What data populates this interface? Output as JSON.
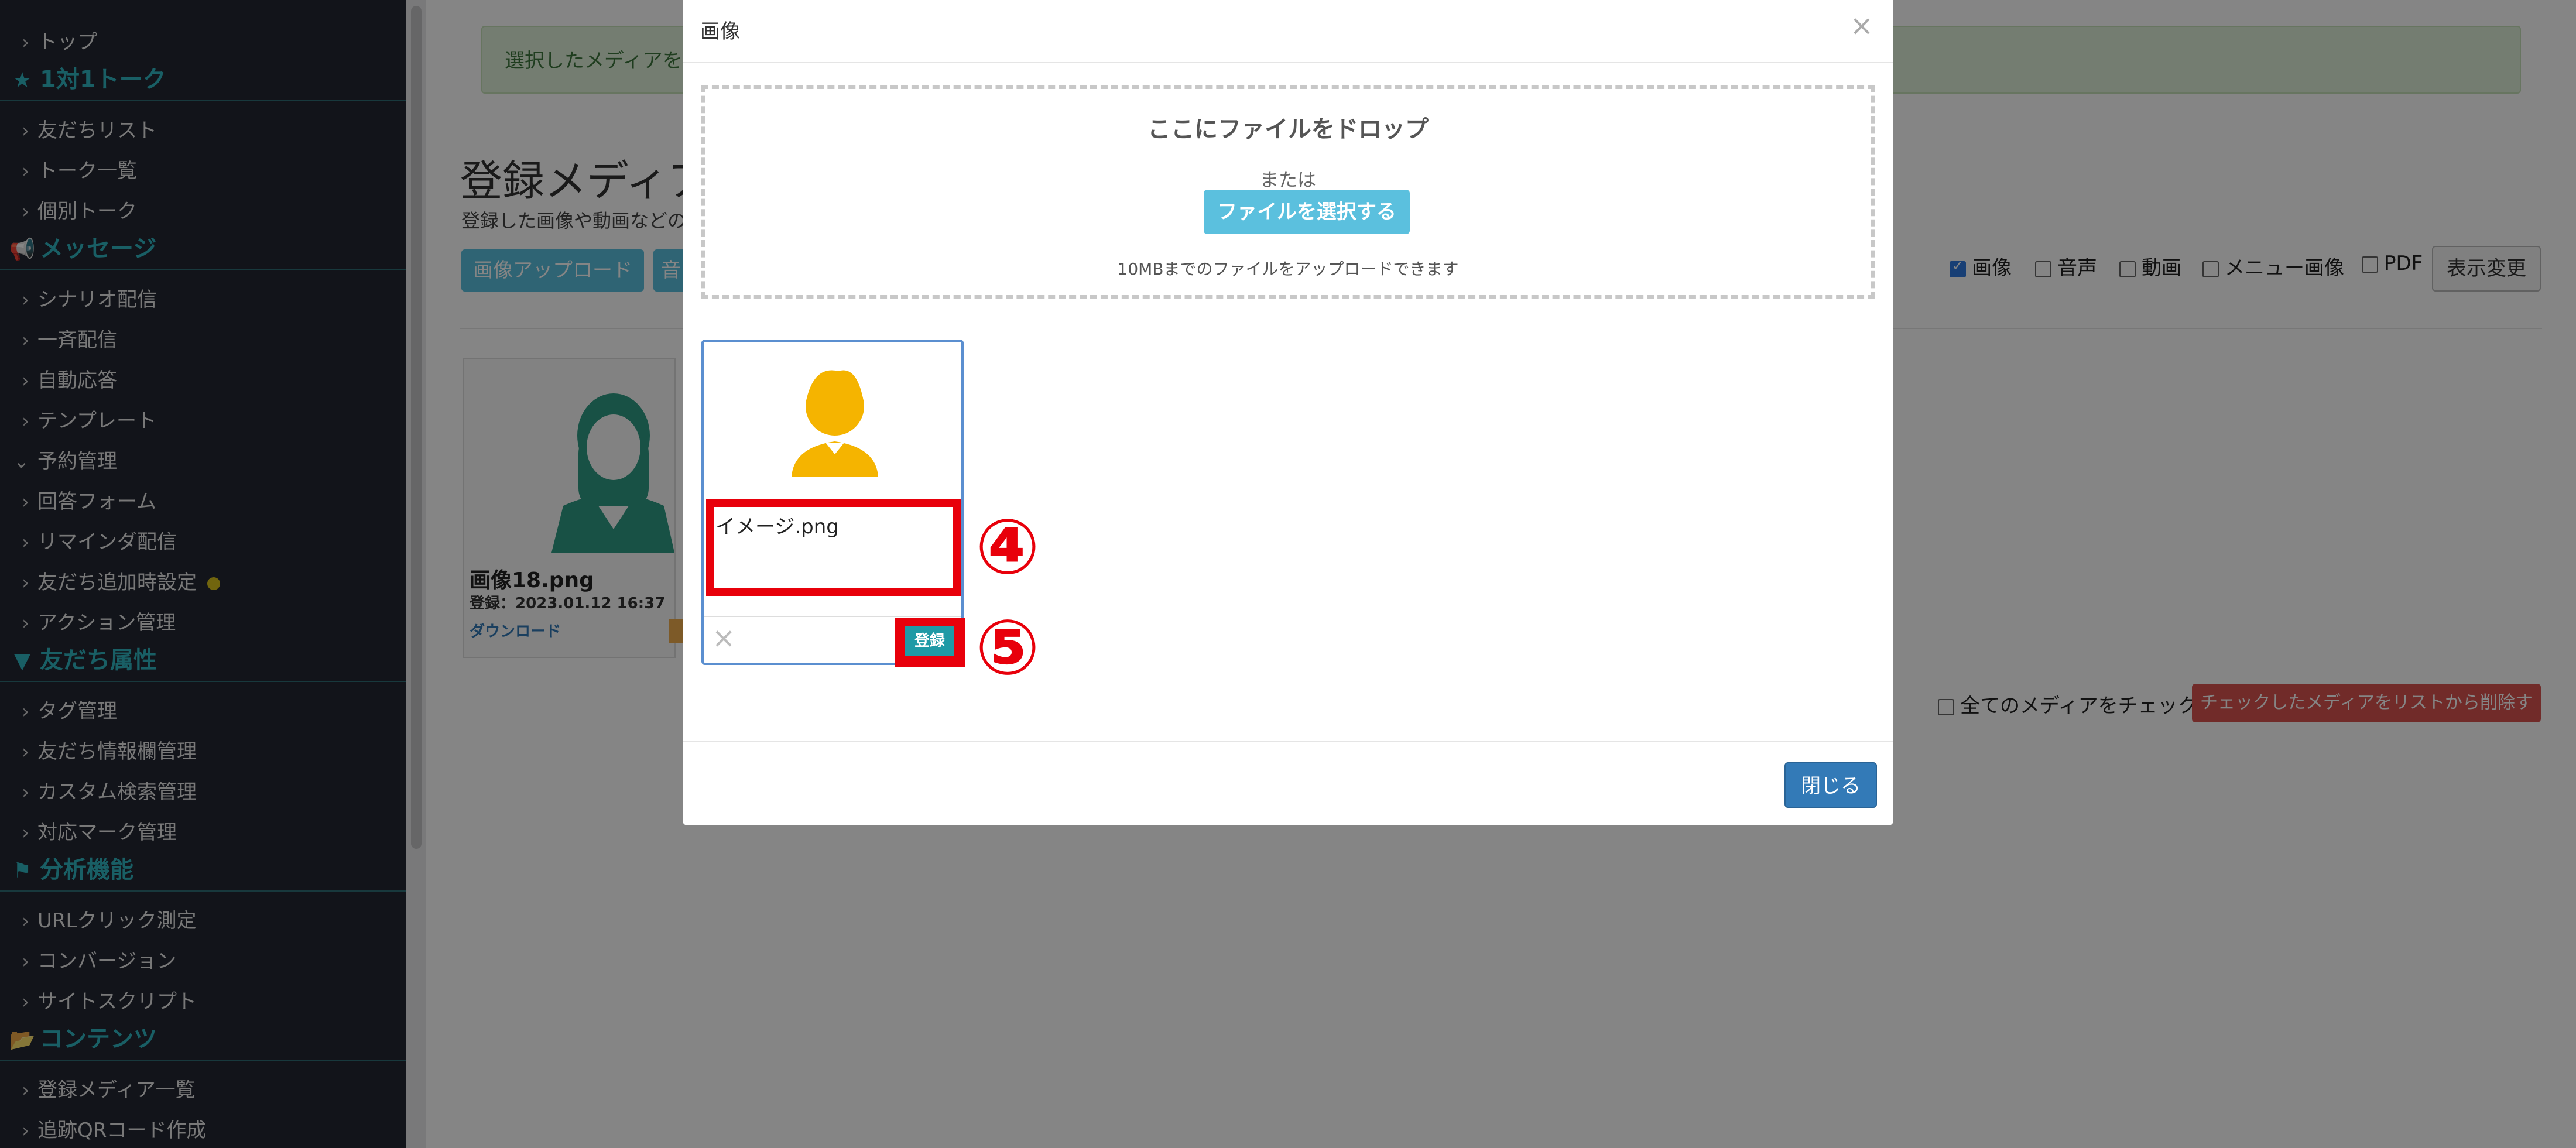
{
  "sidebar": {
    "items": [
      {
        "type": "item",
        "label": "トップ"
      },
      {
        "type": "head",
        "icon": "★",
        "label": "1対1トーク"
      },
      {
        "type": "item",
        "label": "友だちリスト"
      },
      {
        "type": "item",
        "label": "トーク一覧"
      },
      {
        "type": "item",
        "label": "個別トーク"
      },
      {
        "type": "head",
        "icon": "📢",
        "label": "メッセージ"
      },
      {
        "type": "item",
        "label": "シナリオ配信"
      },
      {
        "type": "item",
        "label": "一斉配信"
      },
      {
        "type": "item",
        "label": "自動応答"
      },
      {
        "type": "item",
        "label": "テンプレート"
      },
      {
        "type": "item",
        "label": "予約管理",
        "open": true
      },
      {
        "type": "item",
        "label": "回答フォーム"
      },
      {
        "type": "item",
        "label": "リマインダ配信"
      },
      {
        "type": "item",
        "label": "友だち追加時設定",
        "dot": true
      },
      {
        "type": "item",
        "label": "アクション管理"
      },
      {
        "type": "head",
        "icon": "▼",
        "label": "友だち属性"
      },
      {
        "type": "item",
        "label": "タグ管理"
      },
      {
        "type": "item",
        "label": "友だち情報欄管理"
      },
      {
        "type": "item",
        "label": "カスタム検索管理"
      },
      {
        "type": "item",
        "label": "対応マーク管理"
      },
      {
        "type": "head",
        "icon": "⚑",
        "label": "分析機能"
      },
      {
        "type": "item",
        "label": "URLクリック測定"
      },
      {
        "type": "item",
        "label": "コンバージョン"
      },
      {
        "type": "item",
        "label": "サイトスクリプト"
      },
      {
        "type": "head",
        "icon": "📂",
        "label": "コンテンツ"
      },
      {
        "type": "item",
        "label": "登録メディア一覧"
      },
      {
        "type": "item",
        "label": "追跡QRコード作成"
      }
    ]
  },
  "main": {
    "alert": "選択したメディアをリ",
    "title": "登録メディア",
    "desc": "登録した画像や動画などの",
    "upload_image_btn": "画像アップロード",
    "upload_other_btn": "音",
    "card": {
      "name": "画像18.png",
      "date": "登録：2023.01.12 16:37",
      "download": "ダウンロード"
    },
    "filters": {
      "image": "画像",
      "audio": "音声",
      "video": "動画",
      "menu_image": "メニュー画像",
      "pdf": "PDF"
    },
    "display_change": "表示変更",
    "check_all": "全てのメディアをチェック",
    "delete_checked": "チェックしたメディアをリストから削除する"
  },
  "modal": {
    "title": "画像",
    "close_x": "×",
    "drop_title": "ここにファイルをドロップ",
    "drop_or": "または",
    "select_file": "ファイルを選択する",
    "drop_note": "10MBまでのファイルをアップロードできます",
    "file_name": "イメージ.png",
    "remove_x": "×",
    "register": "登録",
    "close_button": "閉じる",
    "step4": "④",
    "step5": "⑤"
  },
  "colors": {
    "sidebar_bg": "#232732",
    "accent": "#30b6c2",
    "annotation_red": "#e8000b",
    "primary": "#337ab7"
  }
}
